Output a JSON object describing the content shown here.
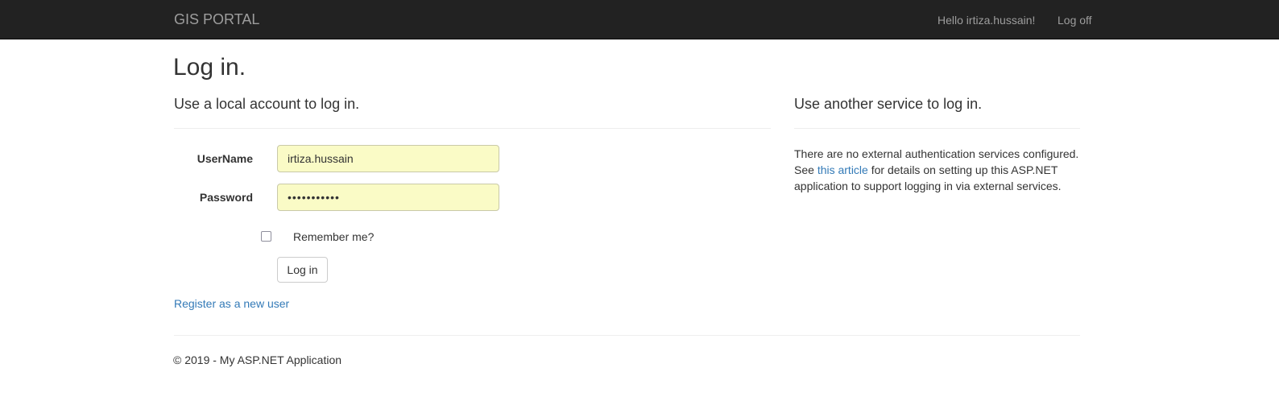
{
  "navbar": {
    "brand": "GIS PORTAL",
    "greeting": "Hello irtiza.hussain!",
    "logoff": "Log off"
  },
  "page": {
    "title": "Log in."
  },
  "local_login": {
    "heading": "Use a local account to log in.",
    "username_label": "UserName",
    "username_value": "irtiza.hussain",
    "password_label": "Password",
    "password_value": "•••••••••••",
    "remember_label": "Remember me?",
    "remember_checked": false,
    "login_button": "Log in",
    "register_link": "Register as a new user"
  },
  "external_login": {
    "heading": "Use another service to log in.",
    "text_before": "There are no external authentication services configured. See ",
    "article_link": "this article",
    "text_after": " for details on setting up this ASP.NET application to support logging in via external services."
  },
  "footer": {
    "text": "© 2019 - My ASP.NET Application"
  },
  "colors": {
    "navbar_bg": "#222222",
    "navbar_text": "#9d9d9d",
    "link": "#337ab7",
    "autofill_bg": "#fafbc6"
  }
}
